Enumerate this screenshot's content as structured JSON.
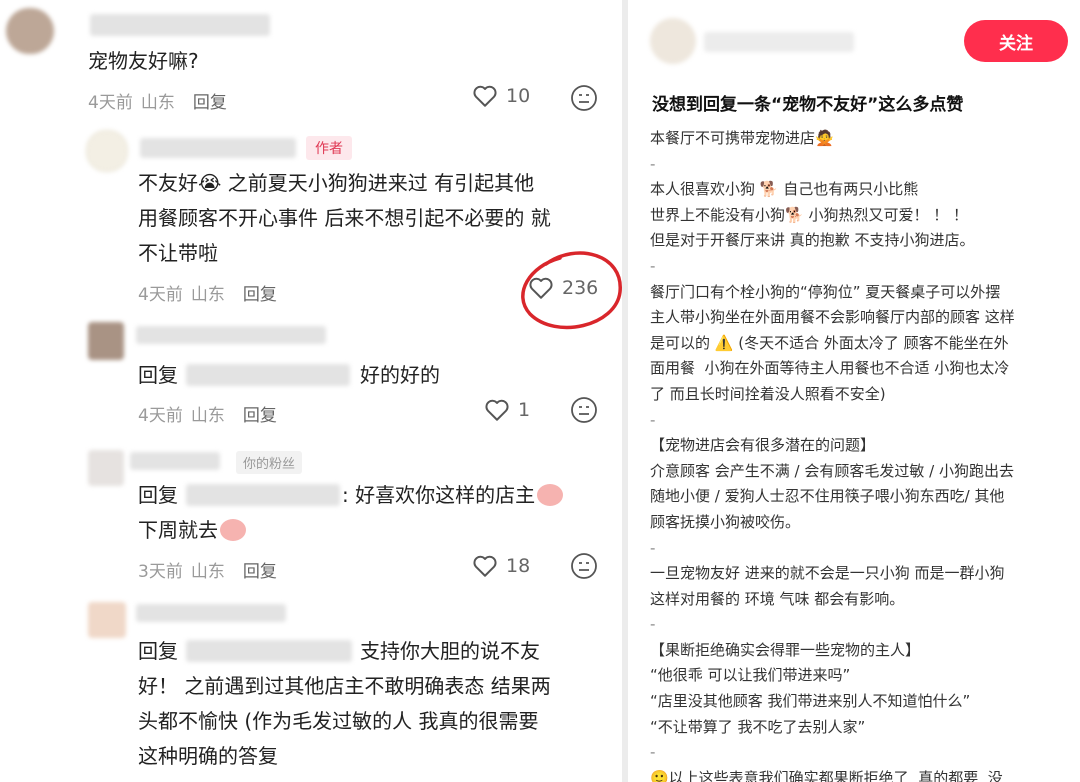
{
  "left": {
    "c1": {
      "text": "宠物友好嘛?",
      "time": "4天前",
      "loc": "山东",
      "reply": "回复",
      "likes": "10"
    },
    "c2": {
      "tag": "作者",
      "text": [
        "不友好😭 之前夏天小狗狗进来过  有引起其他",
        "用餐顾客不开心事件  后来不想引起不必要的 就",
        "不让带啦"
      ],
      "time": "4天前",
      "loc": "山东",
      "reply": "回复",
      "likes": "236"
    },
    "c3": {
      "reply_prefix": "回复",
      "text_after": "好的好的",
      "time": "4天前",
      "loc": "山东",
      "reply": "回复",
      "likes": "1"
    },
    "c4": {
      "tag": "你的粉丝",
      "reply_prefix": "回复",
      "text_after": ": 好喜欢你这样的店主",
      "line2": "下周就去",
      "time": "3天前",
      "loc": "山东",
      "reply": "回复",
      "likes": "18"
    },
    "c5": {
      "reply_prefix": "回复",
      "text_after": "支持你大胆的说不友",
      "lines": [
        "好！ 之前遇到过其他店主不敢明确表态  结果两",
        "头都不愉快 (作为毛发过敏的人  我真的很需要",
        "这种明确的答复"
      ]
    }
  },
  "right": {
    "follow": "关注",
    "title": "没想到回复一条“宠物不友好”这么多点赞",
    "body": [
      "本餐厅不可携带宠物进店🙅",
      "-",
      "本人很喜欢小狗 🐕 自己也有两只小比熊",
      "世界上不能没有小狗🐕 小狗热烈又可爱！ ！ ！",
      "但是对于开餐厅来讲 真的抱歉 不支持小狗进店。",
      "-",
      "餐厅门口有个栓小狗的“停狗位” 夏天餐桌子可以外摆",
      "主人带小狗坐在外面用餐不会影响餐厅内部的顾客 这样",
      "是可以的 ⚠️ (冬天不适合 外面太冷了 顾客不能坐在外",
      "面用餐  小狗在外面等待主人用餐也不合适 小狗也太冷",
      "了 而且长时间拴着没人照看不安全)",
      "-",
      "【宠物进店会有很多潜在的问题】",
      "介意顾客 会产生不满 / 会有顾客毛发过敏 / 小狗跑出去",
      "随地小便 / 爱狗人士忍不住用筷子喂小狗东西吃/ 其他",
      "顾客抚摸小狗被咬伤。",
      "-",
      "一旦宠物友好 进来的就不会是一只小狗 而是一群小狗",
      "这样对用餐的 环境 气味 都会有影响。",
      "-",
      "【果断拒绝确实会得罪一些宠物的主人】",
      "“他很乖 可以让我们带进来吗”",
      "“店里没其他顾客 我们带进来别人不知道怕什么”",
      "“不让带算了 我不吃了去别人家”",
      "-",
      "🙂以上这些表意我们确实都果断拒绝了  真的都要  没"
    ]
  },
  "colors": {
    "accent": "#ff2e4d",
    "annotation": "#d9262b"
  }
}
